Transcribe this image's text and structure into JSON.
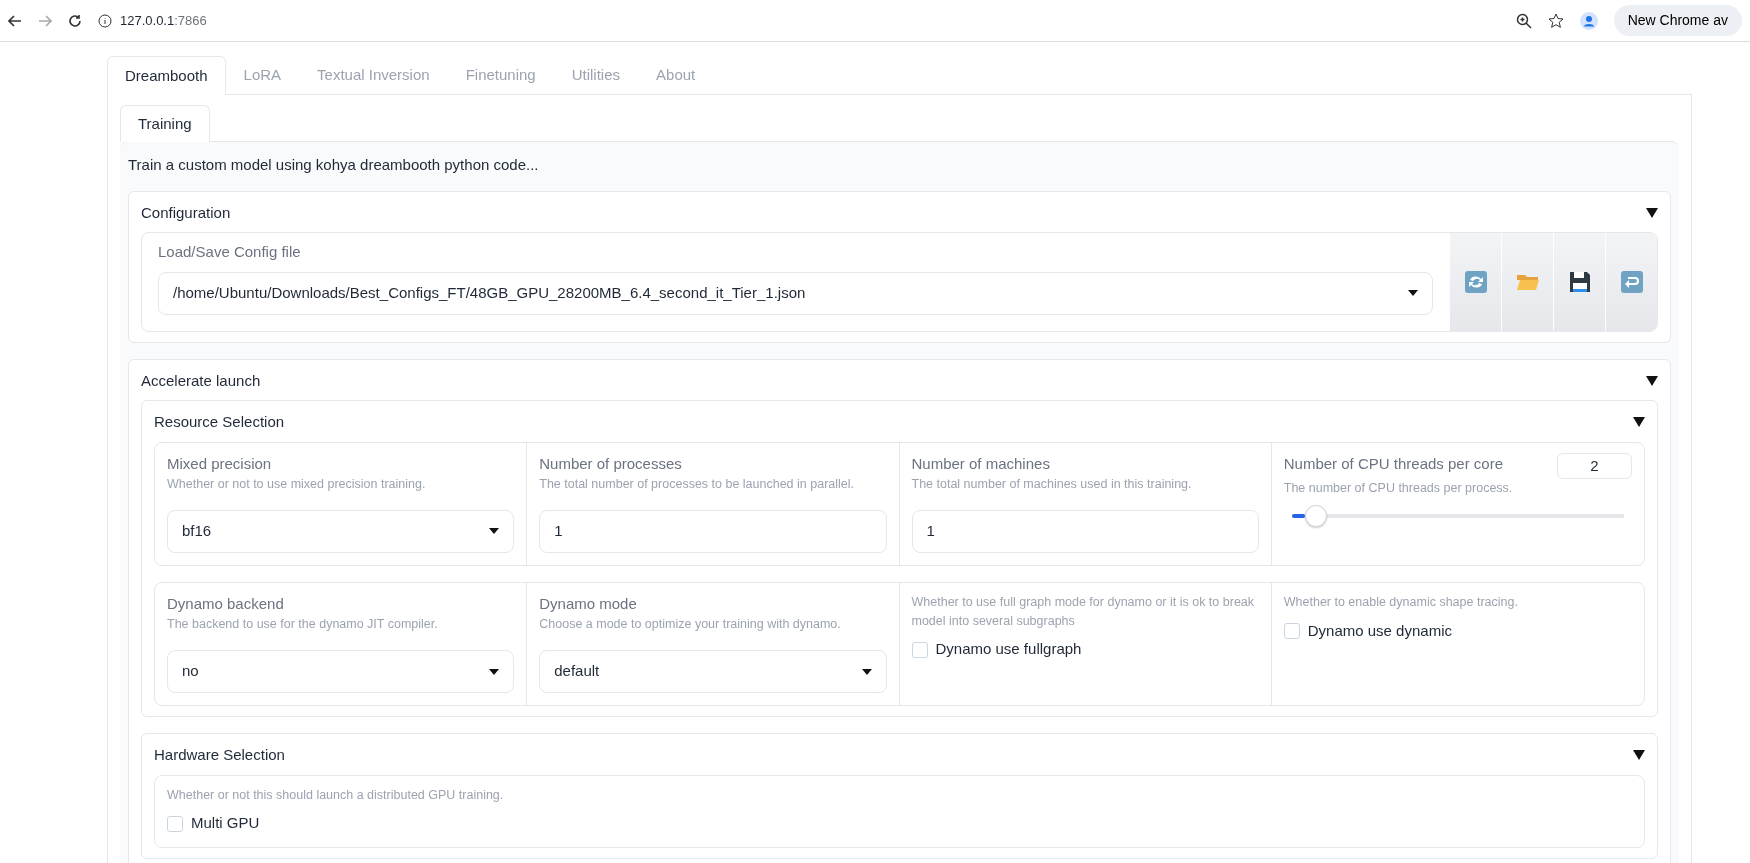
{
  "browser": {
    "url_host": "127.0.0.1",
    "url_port": ":7866",
    "profile_button": "New Chrome av"
  },
  "tabs": [
    {
      "label": "Dreambooth",
      "selected": true
    },
    {
      "label": "LoRA",
      "selected": false
    },
    {
      "label": "Textual Inversion",
      "selected": false
    },
    {
      "label": "Finetuning",
      "selected": false
    },
    {
      "label": "Utilities",
      "selected": false
    },
    {
      "label": "About",
      "selected": false
    }
  ],
  "subtabs": [
    {
      "label": "Training",
      "selected": true
    }
  ],
  "description": "Train a custom model using kohya dreambooth python code...",
  "configuration": {
    "title": "Configuration",
    "expanded": true,
    "label": "Load/Save Config file",
    "value": "/home/Ubuntu/Downloads/Best_Configs_FT/48GB_GPU_28200MB_6.4_second_it_Tier_1.json",
    "buttons": [
      {
        "kind": "refresh"
      },
      {
        "kind": "open"
      },
      {
        "kind": "save"
      },
      {
        "kind": "return"
      }
    ]
  },
  "accelerate": {
    "title": "Accelerate launch",
    "expanded": true,
    "resource": {
      "title": "Resource Selection",
      "expanded": true,
      "rows": [
        [
          {
            "kind": "select",
            "label": "Mixed precision",
            "info": "Whether or not to use mixed precision training.",
            "value": "bf16"
          },
          {
            "kind": "number",
            "label": "Number of processes",
            "info": "The total number of processes to be launched in parallel.",
            "value": "1"
          },
          {
            "kind": "number",
            "label": "Number of machines",
            "info": "The total number of machines used in this training.",
            "value": "1"
          },
          {
            "kind": "slider",
            "label": "Number of CPU threads per core",
            "info": "The number of CPU threads per process.",
            "value": "2",
            "level": 0.04
          }
        ],
        [
          {
            "kind": "select",
            "label": "Dynamo backend",
            "info": "The backend to use for the dynamo JIT compiler.",
            "value": "no"
          },
          {
            "kind": "select",
            "label": "Dynamo mode",
            "info": "Choose a mode to optimize your training with dynamo.",
            "value": "default"
          },
          {
            "kind": "checkbox",
            "info": "Whether to use full graph mode for dynamo or it is ok to break model into several subgraphs",
            "label": "Dynamo use fullgraph",
            "checked": false
          },
          {
            "kind": "checkbox",
            "info": "Whether to enable dynamic shape tracing.",
            "label": "Dynamo use dynamic",
            "checked": false
          }
        ]
      ]
    },
    "hardware": {
      "title": "Hardware Selection",
      "expanded": true,
      "info": "Whether or not this should launch a distributed GPU training.",
      "label": "Multi GPU",
      "checked": false
    }
  }
}
